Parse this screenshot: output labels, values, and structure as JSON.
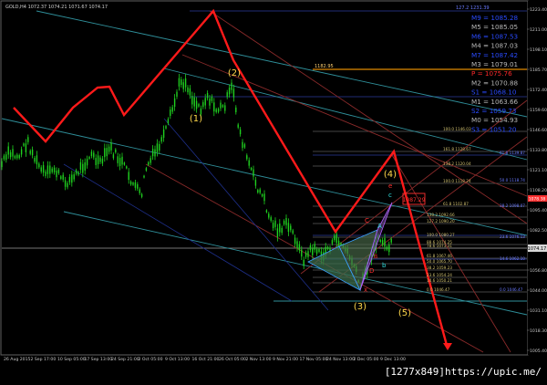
{
  "header": {
    "symbol_title": "GOLD,H4 1072.37 1074.21 1071.67 1074.17"
  },
  "watermark": "[1277x849]https://upic.me/",
  "price_axis": {
    "labels": [
      "1223.40",
      "1211.00",
      "1198.10",
      "1185.70",
      "1172.40",
      "1159.60",
      "1146.60",
      "1133.80",
      "1121.10",
      "1108.20",
      "1095.40",
      "1082.50",
      "1069.70",
      "1056.80",
      "1044.00",
      "1031.10",
      "1018.30",
      "1005.40"
    ],
    "current_price": "1074.17",
    "marker_price": "1078.38"
  },
  "time_axis": {
    "labels": [
      "26 Aug 2015",
      "2 Sep 17:00",
      "10 Sep 05:00",
      "17 Sep 13:00",
      "24 Sep 21:00",
      "2 Oct 05:00",
      "9 Oct 13:00",
      "16 Oct 21:00",
      "26 Oct 05:00",
      "2 Nov 13:00",
      "9 Nov 21:00",
      "17 Nov 05:00",
      "24 Nov 13:00",
      "2 Dec 05:00",
      "9 Dec 13:00"
    ]
  },
  "moving_averages": [
    {
      "label": "M9 = 1085.28",
      "color": "#2a4bff"
    },
    {
      "label": "M5 = 1085.05",
      "color": "#b8b8b8"
    },
    {
      "label": "M6 = 1087.53",
      "color": "#2a4bff"
    },
    {
      "label": "M4 = 1087.03",
      "color": "#b8b8b8"
    },
    {
      "label": "M7 = 1087.42",
      "color": "#2a4bff"
    },
    {
      "label": "M3 = 1079.01",
      "color": "#b8b8b8"
    },
    {
      "label": "P = 1075.76",
      "color": "#ff2a2a"
    },
    {
      "label": "M2 = 1070.88",
      "color": "#b8b8b8"
    },
    {
      "label": "S1 = 1068.10",
      "color": "#2a4bff"
    },
    {
      "label": "M1 = 1063.66",
      "color": "#b8b8b8"
    },
    {
      "label": "S2 = 1059.73",
      "color": "#2a4bff"
    },
    {
      "label": "M0 = 1054.93",
      "color": "#b8b8b8"
    },
    {
      "label": "S3 = 1051.20",
      "color": "#2a4bff"
    }
  ],
  "fib_levels": [
    {
      "label": "100.0 1146.03"
    },
    {
      "label": "161.8 1128.67"
    },
    {
      "label": "138.2 1120.04"
    },
    {
      "label": "100.0 1118.24"
    },
    {
      "label": "61.8 1102.87"
    },
    {
      "label": "138.2 1092.66"
    },
    {
      "label": "127.2 1090.20"
    },
    {
      "label": "100.0 1080.27"
    },
    {
      "label": "88.6 1074.25"
    },
    {
      "label": "78.6 1073.31"
    },
    {
      "label": "61.8 1067.46"
    },
    {
      "label": "50.0 1065.70"
    },
    {
      "label": "38.2 1059.23"
    },
    {
      "label": "23.6 1054.24"
    },
    {
      "label": "14.6 1050.21"
    },
    {
      "label": "0.0 1046.47"
    }
  ],
  "right_fib_levels": [
    {
      "label": "61.8 1139.87"
    },
    {
      "label": "50.0 1118.74"
    },
    {
      "label": "38.2 1098.07"
    },
    {
      "label": "23.6 1076.13"
    },
    {
      "label": "14.6 1062.10"
    },
    {
      "label": "0.0 1046.47"
    }
  ],
  "top_right_level": "127.2 1231.39",
  "orange_level": "1182.95",
  "wave_labels": [
    "(1)",
    "(2)",
    "(3)",
    "(4)",
    "(5)"
  ],
  "harmonic_labels": {
    "X": "X",
    "A": "A",
    "B": "B",
    "C": "C",
    "D": "D",
    "e": "e",
    "c": "c",
    "b": "b"
  },
  "prz_box": "1087.29"
}
